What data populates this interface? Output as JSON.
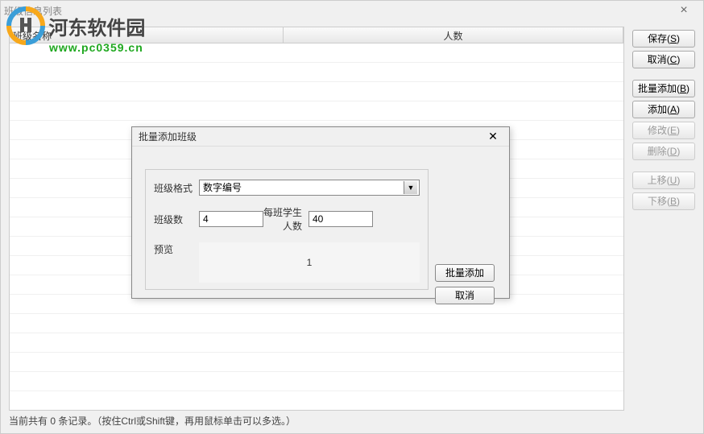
{
  "window": {
    "title": "班级信息列表"
  },
  "watermark": {
    "text1": "河东软件园",
    "text2": "www.pc0359.cn"
  },
  "table": {
    "col1": "班级名称",
    "col2": "人数"
  },
  "sidebar": {
    "save": "保存(S)",
    "cancel": "取消(C)",
    "batch_add": "批量添加(B)",
    "add": "添加(A)",
    "modify": "修改(E)",
    "delete": "删除(D)",
    "move_up": "上移(U)",
    "move_down": "下移(B)"
  },
  "status": "当前共有 0 条记录。（按住Ctrl或Shift键，再用鼠标单击可以多选。）",
  "dialog": {
    "title": "批量添加班级",
    "format_label": "班级格式",
    "format_value": "数字编号",
    "count_label": "班级数",
    "count_value": "4",
    "students_label": "每班学生人数",
    "students_value": "40",
    "preview_label": "预览",
    "preview_value": "1",
    "batch_add_btn": "批量添加",
    "cancel_btn": "取消"
  }
}
